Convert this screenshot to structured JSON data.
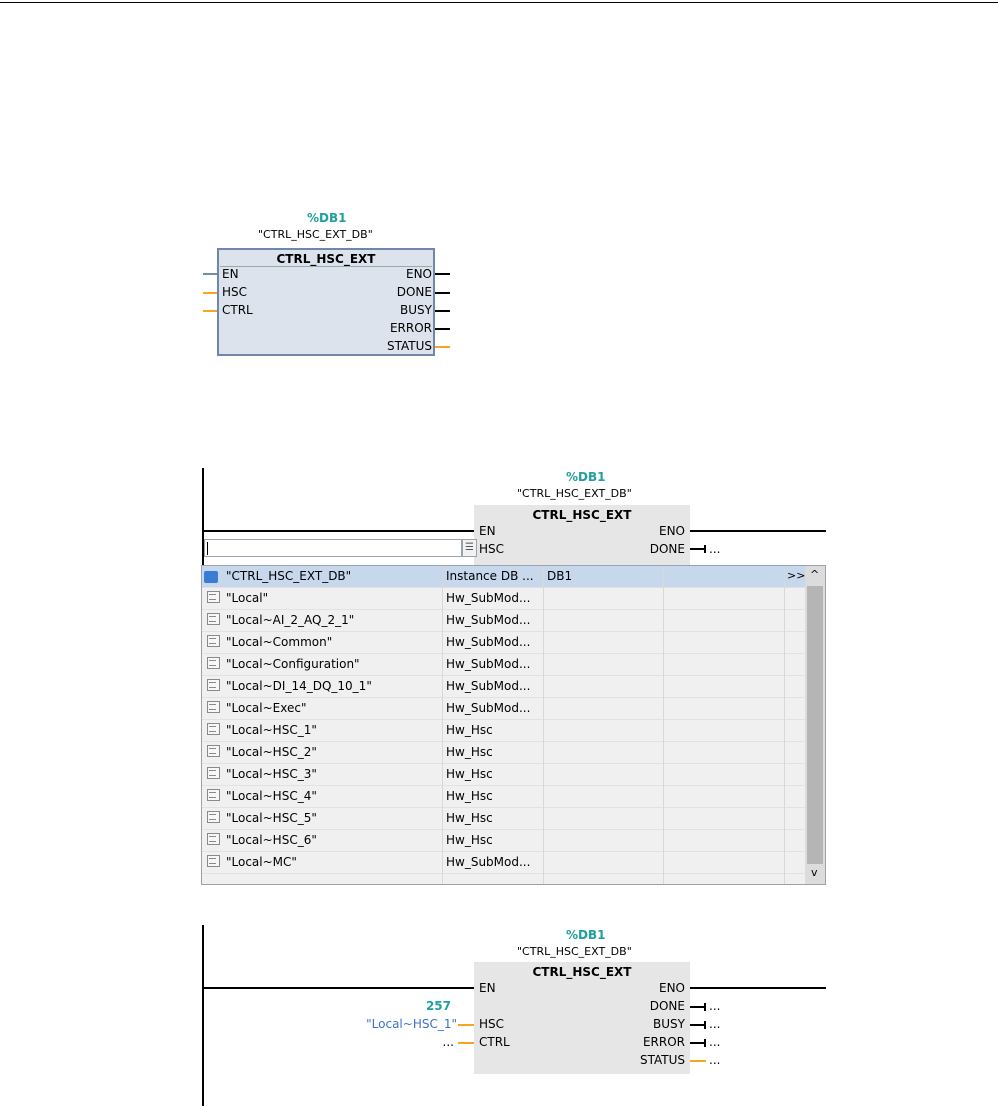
{
  "block1": {
    "db_number": "%DB1",
    "db_name": "\"CTRL_HSC_EXT_DB\"",
    "title": "CTRL_HSC_EXT",
    "inputs": [
      "EN",
      "HSC",
      "CTRL"
    ],
    "outputs": [
      "ENO",
      "DONE",
      "BUSY",
      "ERROR",
      "STATUS"
    ]
  },
  "block2": {
    "db_number": "%DB1",
    "db_name": "\"CTRL_HSC_EXT_DB\"",
    "title": "CTRL_HSC_EXT",
    "inputs": [
      "EN",
      "HSC"
    ],
    "outputs": [
      "ENO",
      "DONE"
    ],
    "done_value": "...",
    "input_placeholder": "",
    "list_button": "☰"
  },
  "dropdown": {
    "scroll_up": "^",
    "scroll_down": "v",
    "expand": ">>",
    "rows": [
      {
        "icon": "instance-db-icon",
        "name": "\"CTRL_HSC_EXT_DB\"",
        "type": "Instance DB ...",
        "address": "DB1"
      },
      {
        "icon": "hardware-icon",
        "name": "\"Local\"",
        "type": "Hw_SubMod...",
        "address": ""
      },
      {
        "icon": "hardware-icon",
        "name": "\"Local~AI_2_AQ_2_1\"",
        "type": "Hw_SubMod...",
        "address": ""
      },
      {
        "icon": "hardware-icon",
        "name": "\"Local~Common\"",
        "type": "Hw_SubMod...",
        "address": ""
      },
      {
        "icon": "hardware-icon",
        "name": "\"Local~Configuration\"",
        "type": "Hw_SubMod...",
        "address": ""
      },
      {
        "icon": "hardware-icon",
        "name": "\"Local~DI_14_DQ_10_1\"",
        "type": "Hw_SubMod...",
        "address": ""
      },
      {
        "icon": "hardware-icon",
        "name": "\"Local~Exec\"",
        "type": "Hw_SubMod...",
        "address": ""
      },
      {
        "icon": "hardware-icon",
        "name": "\"Local~HSC_1\"",
        "type": "Hw_Hsc",
        "address": ""
      },
      {
        "icon": "hardware-icon",
        "name": "\"Local~HSC_2\"",
        "type": "Hw_Hsc",
        "address": ""
      },
      {
        "icon": "hardware-icon",
        "name": "\"Local~HSC_3\"",
        "type": "Hw_Hsc",
        "address": ""
      },
      {
        "icon": "hardware-icon",
        "name": "\"Local~HSC_4\"",
        "type": "Hw_Hsc",
        "address": ""
      },
      {
        "icon": "hardware-icon",
        "name": "\"Local~HSC_5\"",
        "type": "Hw_Hsc",
        "address": ""
      },
      {
        "icon": "hardware-icon",
        "name": "\"Local~HSC_6\"",
        "type": "Hw_Hsc",
        "address": ""
      },
      {
        "icon": "hardware-icon",
        "name": "\"Local~MC\"",
        "type": "Hw_SubMod...",
        "address": ""
      }
    ]
  },
  "block3": {
    "db_number": "%DB1",
    "db_name": "\"CTRL_HSC_EXT_DB\"",
    "title": "CTRL_HSC_EXT",
    "inputs": [
      "EN",
      "HSC",
      "CTRL"
    ],
    "outputs": [
      "ENO",
      "DONE",
      "BUSY",
      "ERROR",
      "STATUS"
    ],
    "hsc_value": "257",
    "hsc_tag": "\"Local~HSC_1\"",
    "ctrl_value": "...",
    "output_values": [
      "...",
      "...",
      "...",
      "..."
    ]
  },
  "colors": {
    "teal": "#21a09f",
    "orange": "#f5a623",
    "block_fill": "#dde3ed",
    "block_border": "#6f88a8",
    "selection": "#c8d8ec",
    "tag_blue": "#3d72c8"
  }
}
